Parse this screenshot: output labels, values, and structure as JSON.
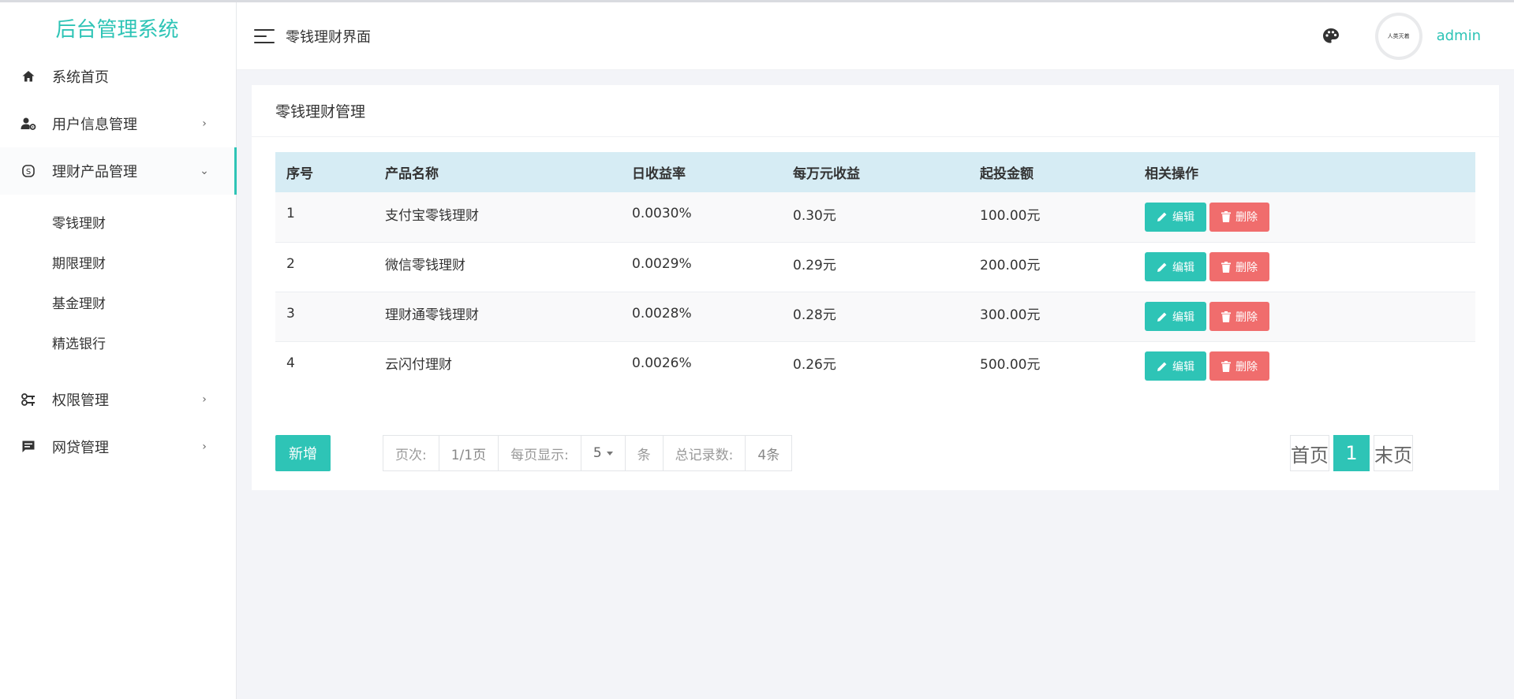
{
  "app": {
    "title": "后台管理系统"
  },
  "sidebar": {
    "items": [
      {
        "label": "系统首页",
        "icon": "home-icon",
        "arrow": ""
      },
      {
        "label": "用户信息管理",
        "icon": "user-gear-icon",
        "arrow": "›"
      },
      {
        "label": "理财产品管理",
        "icon": "finance-icon",
        "arrow": "⌄"
      },
      {
        "label": "权限管理",
        "icon": "key-icon",
        "arrow": "›"
      },
      {
        "label": "网贷管理",
        "icon": "message-icon",
        "arrow": "›"
      }
    ],
    "submenu": [
      "零钱理财",
      "期限理财",
      "基金理财",
      "精选银行"
    ]
  },
  "header": {
    "title": "零钱理财界面",
    "avatar_text": "人类灭着",
    "username": "admin"
  },
  "panel": {
    "title": "零钱理财管理",
    "columns": [
      "序号",
      "产品名称",
      "日收益率",
      "每万元收益",
      "起投金额",
      "相关操作"
    ],
    "rows": [
      [
        "1",
        "支付宝零钱理财",
        "0.0030%",
        "0.30元",
        "100.00元"
      ],
      [
        "2",
        "微信零钱理财",
        "0.0029%",
        "0.29元",
        "200.00元"
      ],
      [
        "3",
        "理财通零钱理财",
        "0.0028%",
        "0.28元",
        "300.00元"
      ],
      [
        "4",
        "云闪付理财",
        "0.0026%",
        "0.26元",
        "500.00元"
      ]
    ],
    "edit_label": "编辑",
    "delete_label": "删除",
    "add_label": "新增"
  },
  "pagination": {
    "page_label": "页次:",
    "page_value": "1/1页",
    "size_label": "每页显示:",
    "size_value": "5",
    "size_unit": "条",
    "total_label": "总记录数:",
    "total_value": "4条",
    "first": "首页",
    "current": "1",
    "last": "末页"
  },
  "colors": {
    "accent": "#2ec4b6",
    "danger": "#f06d6d",
    "header_row": "#d6ecf4"
  }
}
